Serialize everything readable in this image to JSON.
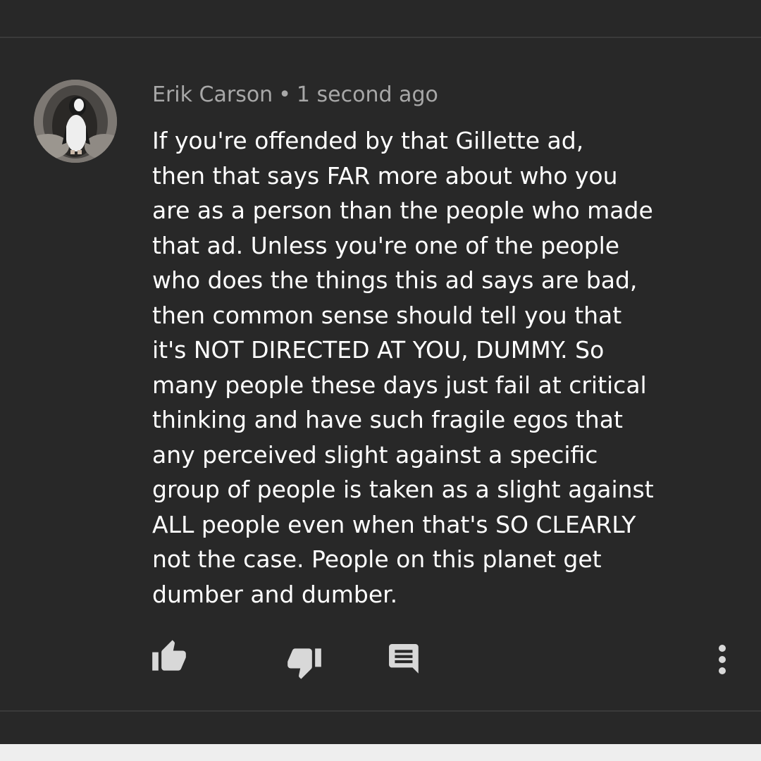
{
  "comment": {
    "author": "Erik Carson",
    "separator": "•",
    "timestamp": "1 second ago",
    "avatar_icon": "penguin-avatar",
    "lines": [
      "If you're offended by that Gillette ad,",
      "then that says FAR more about who you",
      "are as a person than the people who made",
      "that ad. Unless you're one of the people",
      "who does the things this ad says are bad,",
      "then common sense should tell you that",
      "it's NOT DIRECTED AT YOU, DUMMY. So",
      "many people these days just fail at critical",
      "thinking and have such fragile egos that",
      "any perceived slight against a specific",
      "group of people is taken as a slight against",
      "ALL people even when that's SO CLEARLY",
      "not the case. People on this planet get",
      "dumber and dumber."
    ]
  },
  "actions": {
    "like_icon": "thumbs-up-icon",
    "dislike_icon": "thumbs-down-icon",
    "reply_icon": "comment-icon",
    "more_icon": "more-vert-icon"
  },
  "colors": {
    "background": "#282828",
    "text": "#ffffff",
    "meta_text": "#a8a8a8",
    "icon": "#d8d8d8"
  }
}
